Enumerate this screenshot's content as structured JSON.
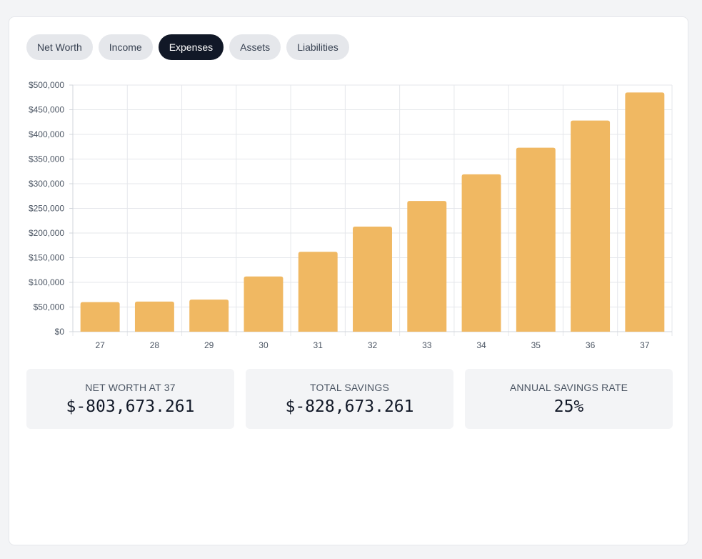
{
  "tabs": [
    {
      "label": "Net Worth",
      "active": false
    },
    {
      "label": "Income",
      "active": false
    },
    {
      "label": "Expenses",
      "active": true
    },
    {
      "label": "Assets",
      "active": false
    },
    {
      "label": "Liabilities",
      "active": false
    }
  ],
  "chart_data": {
    "type": "bar",
    "categories": [
      "27",
      "28",
      "29",
      "30",
      "31",
      "32",
      "33",
      "34",
      "35",
      "36",
      "37"
    ],
    "values": [
      60000,
      61000,
      65000,
      112000,
      162000,
      213000,
      265000,
      319000,
      373000,
      428000,
      485000
    ],
    "ylim": [
      0,
      500000
    ],
    "yticks": [
      0,
      50000,
      100000,
      150000,
      200000,
      250000,
      300000,
      350000,
      400000,
      450000,
      500000
    ],
    "ytick_labels": [
      "$0",
      "$50,000",
      "$100,000",
      "$150,000",
      "$200,000",
      "$250,000",
      "$300,000",
      "$350,000",
      "$400,000",
      "$450,000",
      "$500,000"
    ],
    "bar_color": "#f0b862",
    "grid": true
  },
  "stats": [
    {
      "label": "NET WORTH AT 37",
      "value": "$-803,673.261"
    },
    {
      "label": "TOTAL SAVINGS",
      "value": "$-828,673.261"
    },
    {
      "label": "ANNUAL SAVINGS RATE",
      "value": "25%"
    }
  ]
}
